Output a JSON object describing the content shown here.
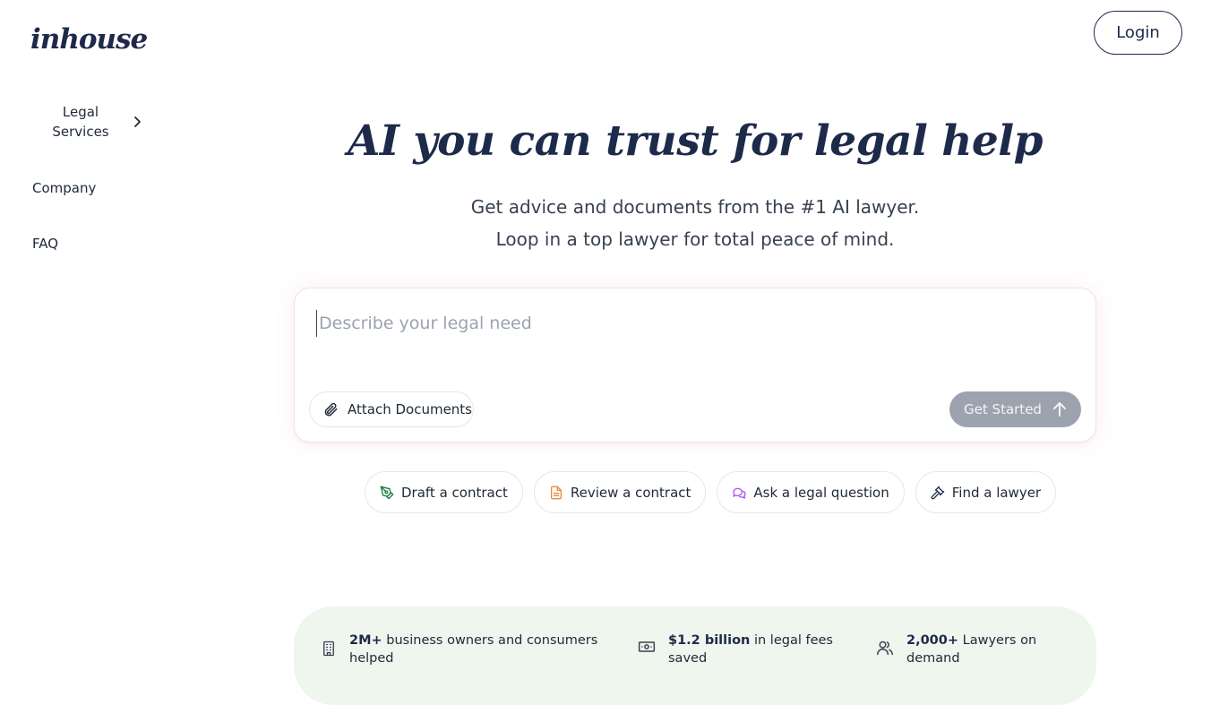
{
  "brand": {
    "logo_text": "inhouse"
  },
  "header": {
    "login_label": "Login"
  },
  "nav": {
    "legal_services": "Legal Services",
    "company": "Company",
    "faq": "FAQ"
  },
  "hero": {
    "title": "AI you can trust for legal help",
    "subtitle_line1": "Get advice and documents from the #1 AI lawyer.",
    "subtitle_line2": "Loop in a top lawyer for total peace of mind."
  },
  "prompt": {
    "placeholder": "Describe your legal need",
    "value": "",
    "attach_label": "Attach Documents",
    "submit_label": "Get Started"
  },
  "chips": [
    {
      "label": "Draft a contract",
      "icon": "pen-nib-icon",
      "color": "#15803d"
    },
    {
      "label": "Review a contract",
      "icon": "document-icon",
      "color": "#ea8a3c"
    },
    {
      "label": "Ask a legal question",
      "icon": "chat-bubbles-icon",
      "color": "#a855f7"
    },
    {
      "label": "Find a lawyer",
      "icon": "gavel-icon",
      "color": "#1e2a4a"
    }
  ],
  "stats": [
    {
      "highlight": "2M+",
      "text": " business owners and consumers helped",
      "icon": "building-icon"
    },
    {
      "highlight": "$1.2 billion",
      "text": " in legal fees saved",
      "icon": "banknote-icon"
    },
    {
      "highlight": "2,000+",
      "text": " Lawyers on demand",
      "icon": "users-icon"
    }
  ],
  "colors": {
    "brand_navy": "#1e2a4a",
    "button_disabled": "#9ca3af",
    "stats_background": "#eef6ee"
  }
}
